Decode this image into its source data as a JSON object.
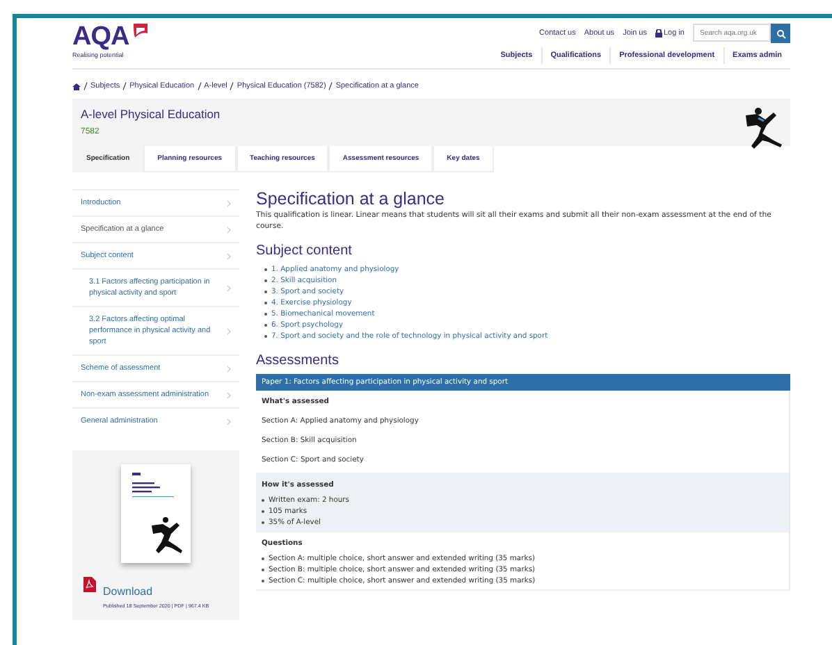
{
  "header": {
    "logo": "AQA",
    "tagline": "Realising potential",
    "top_links": [
      "Contact us",
      "About us",
      "Join us"
    ],
    "login": "Log in",
    "search": {
      "placeholder": "Search aqa.org.uk"
    },
    "nav": [
      "Subjects",
      "Qualifications",
      "Professional development",
      "Exams admin"
    ]
  },
  "breadcrumb": [
    "Subjects",
    "Physical Education",
    "A-level",
    "Physical Education (7582)",
    "Specification at a glance"
  ],
  "course": {
    "title": "A-level Physical Education",
    "code": "7582"
  },
  "tabs": [
    {
      "label": "Specification",
      "selected": true
    },
    {
      "label": "Planning resources",
      "selected": false
    },
    {
      "label": "Teaching resources",
      "selected": false
    },
    {
      "label": "Assessment resources",
      "selected": false
    },
    {
      "label": "Key dates",
      "selected": false
    }
  ],
  "sidebar": {
    "items": [
      {
        "label": "Introduction",
        "selected": false
      },
      {
        "label": "Specification at a glance",
        "selected": true
      },
      {
        "label": "Subject content",
        "selected": false,
        "children": [
          {
            "label": "3.1 Factors affecting participation in physical activity and sport",
            "selected": false
          },
          {
            "label": "3.2 Factors affecting optimal performance in physical activity and sport",
            "selected": false
          }
        ]
      },
      {
        "label": "Scheme of assessment",
        "selected": false
      },
      {
        "label": "Non-exam assessment administration",
        "selected": false
      },
      {
        "label": "General administration",
        "selected": false
      }
    ],
    "download": {
      "label": "Download",
      "meta": "Published 18 September 2020 | PDF | 967.4 KB"
    }
  },
  "main": {
    "title": "Specification at a glance",
    "intro": "This qualification is linear. Linear means that students will sit all their exams and submit all their non-exam assessment at the end of the course.",
    "subject_heading": "Subject content",
    "subject_items": [
      "1. Applied anatomy and physiology",
      "2. Skill acquisition",
      "3. Sport and society",
      "4. Exercise physiology",
      "5. Biomechanical movement",
      "6. Sport psychology",
      "7. Sport and society and the role of technology in physical activity and sport"
    ],
    "assessments_heading": "Assessments",
    "paper": {
      "title": "Paper 1: Factors affecting participation in physical activity and sport",
      "sections": [
        {
          "heading": "What's assessed",
          "kind": "lines",
          "shaded": false,
          "items": [
            "Section A: Applied anatomy and physiology",
            "Section B: Skill acquisition",
            "Section C: Sport and society"
          ]
        },
        {
          "heading": "How it's assessed",
          "kind": "bullets",
          "shaded": true,
          "items": [
            "Written exam: 2 hours",
            "105 marks",
            "35% of A-level"
          ]
        },
        {
          "heading": "Questions",
          "kind": "bullets",
          "shaded": false,
          "items": [
            "Section A: multiple choice, short answer and extended writing (35 marks)",
            "Section B: multiple choice, short answer and extended writing (35 marks)",
            "Section C: multiple choice, short answer and extended writing (35 marks)"
          ]
        }
      ]
    }
  }
}
